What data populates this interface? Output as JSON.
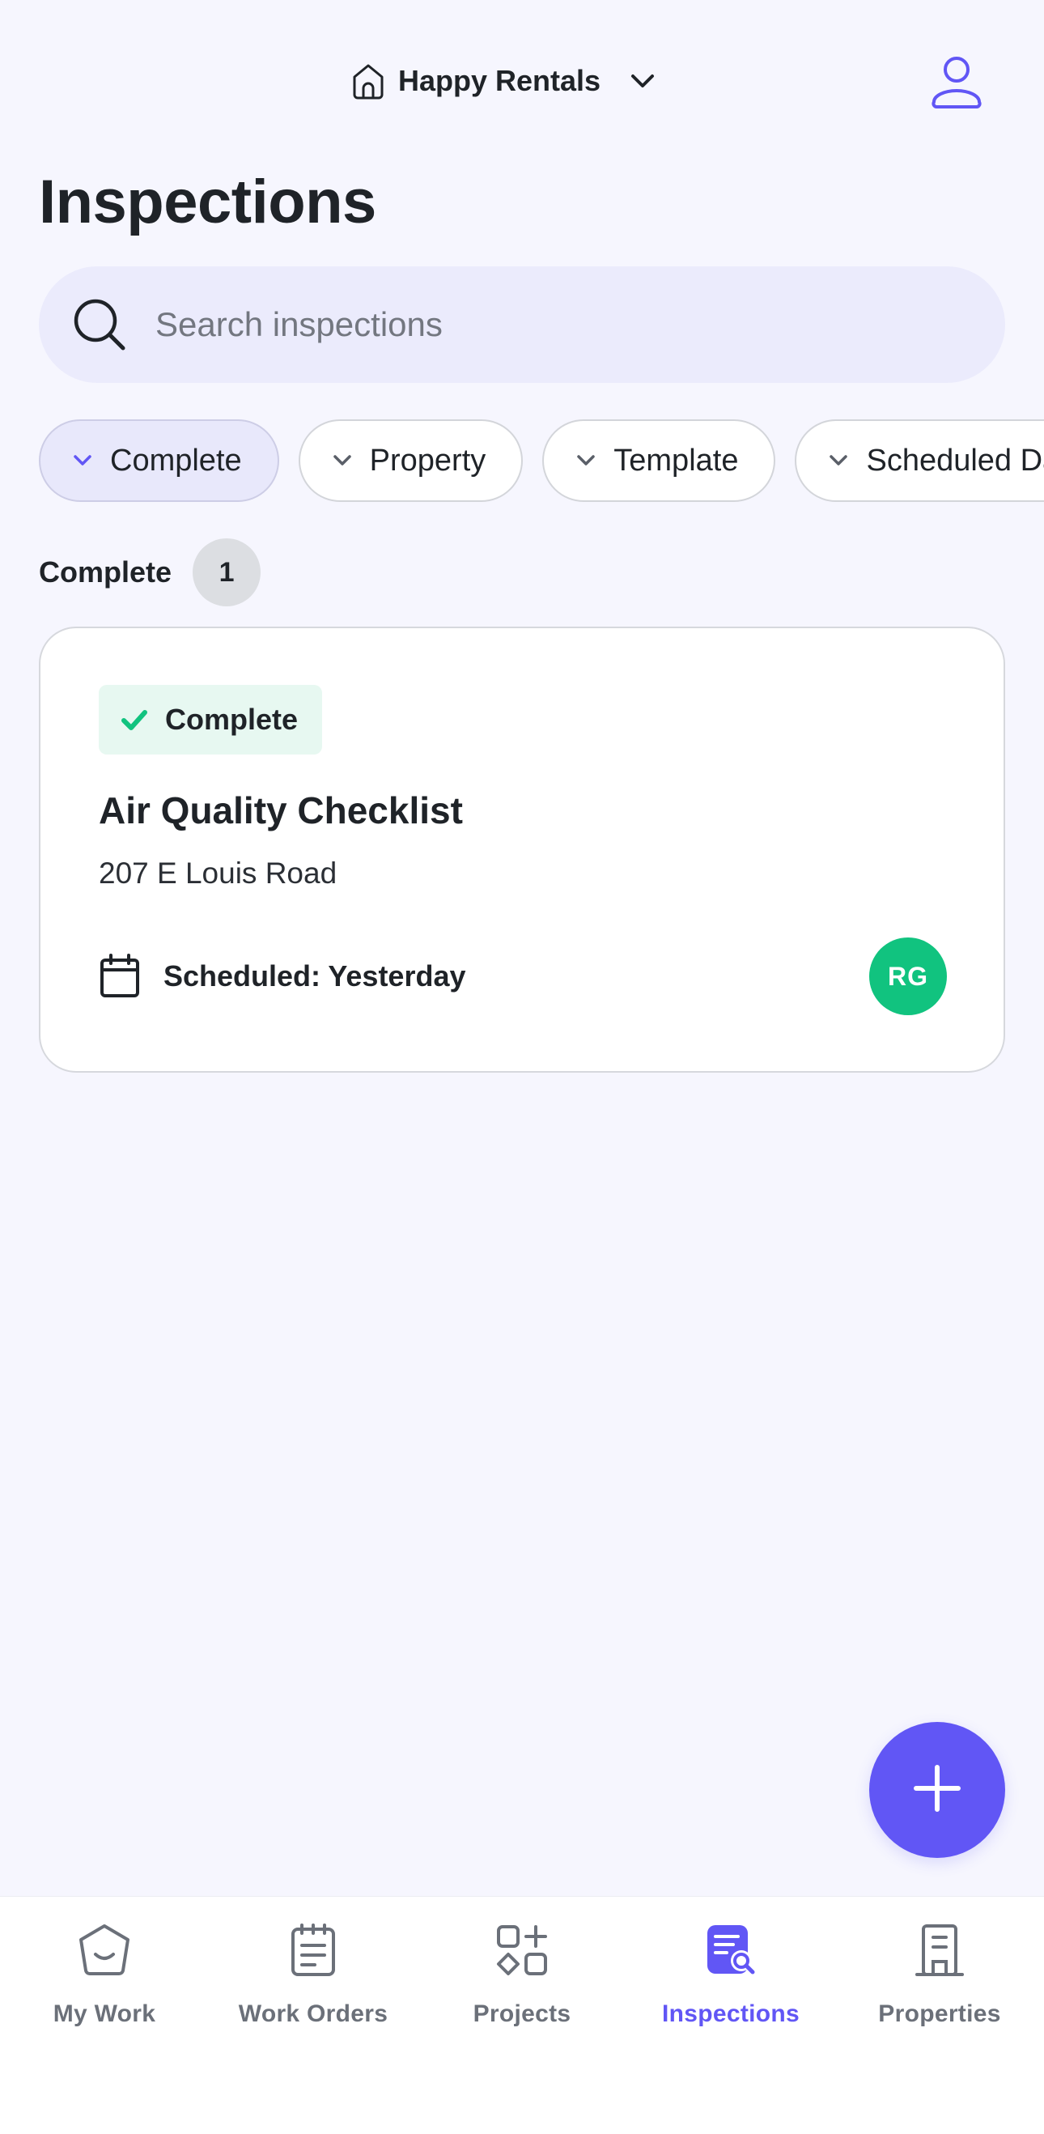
{
  "header": {
    "org_name": "Happy Rentals",
    "org_icon": "home-icon",
    "switch_icon": "chevron-down-icon",
    "profile_icon": "user-icon"
  },
  "page": {
    "title": "Inspections"
  },
  "search": {
    "placeholder": "Search inspections",
    "value": ""
  },
  "filters": [
    {
      "label": "Complete",
      "active": true
    },
    {
      "label": "Property",
      "active": false
    },
    {
      "label": "Template",
      "active": false
    },
    {
      "label": "Scheduled Date",
      "active": false
    }
  ],
  "group": {
    "title": "Complete",
    "count": "1"
  },
  "inspections": [
    {
      "status": "Complete",
      "title": "Air Quality Checklist",
      "address": "207 E Louis Road",
      "schedule": "Scheduled: Yesterday",
      "assignee_initials": "RG",
      "assignee_color": "#11c37f"
    }
  ],
  "fab": {
    "icon": "plus-icon"
  },
  "nav": {
    "items": [
      {
        "label": "My Work",
        "icon": "my-work-icon",
        "active": false
      },
      {
        "label": "Work Orders",
        "icon": "work-orders-icon",
        "active": false
      },
      {
        "label": "Projects",
        "icon": "projects-icon",
        "active": false
      },
      {
        "label": "Inspections",
        "icon": "inspections-icon",
        "active": true
      },
      {
        "label": "Properties",
        "icon": "properties-icon",
        "active": false
      }
    ]
  },
  "colors": {
    "accent": "#6156f5",
    "background": "#f6f6fe",
    "status_complete_bg": "#e7f8f1",
    "status_complete_icon": "#11c37f"
  }
}
